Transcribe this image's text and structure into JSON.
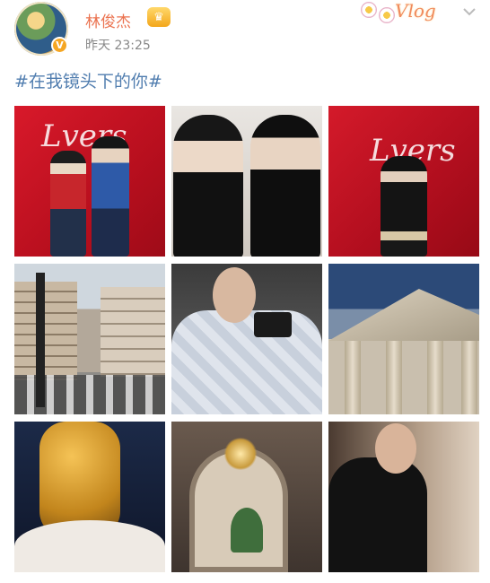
{
  "post": {
    "username": "林俊杰",
    "crown_icon": "crown-icon",
    "verified_mark": "V",
    "timestamp": "昨天 23:25",
    "sticker_text": "Vlog",
    "chevron": "⌄",
    "text": "#在我镜头下的你#"
  },
  "photos": {
    "p1_logo": "Lvers",
    "p3_logo": "Lvers"
  },
  "colors": {
    "username": "#eb7350",
    "hashtag": "#507daf",
    "timestamp": "#888888"
  }
}
